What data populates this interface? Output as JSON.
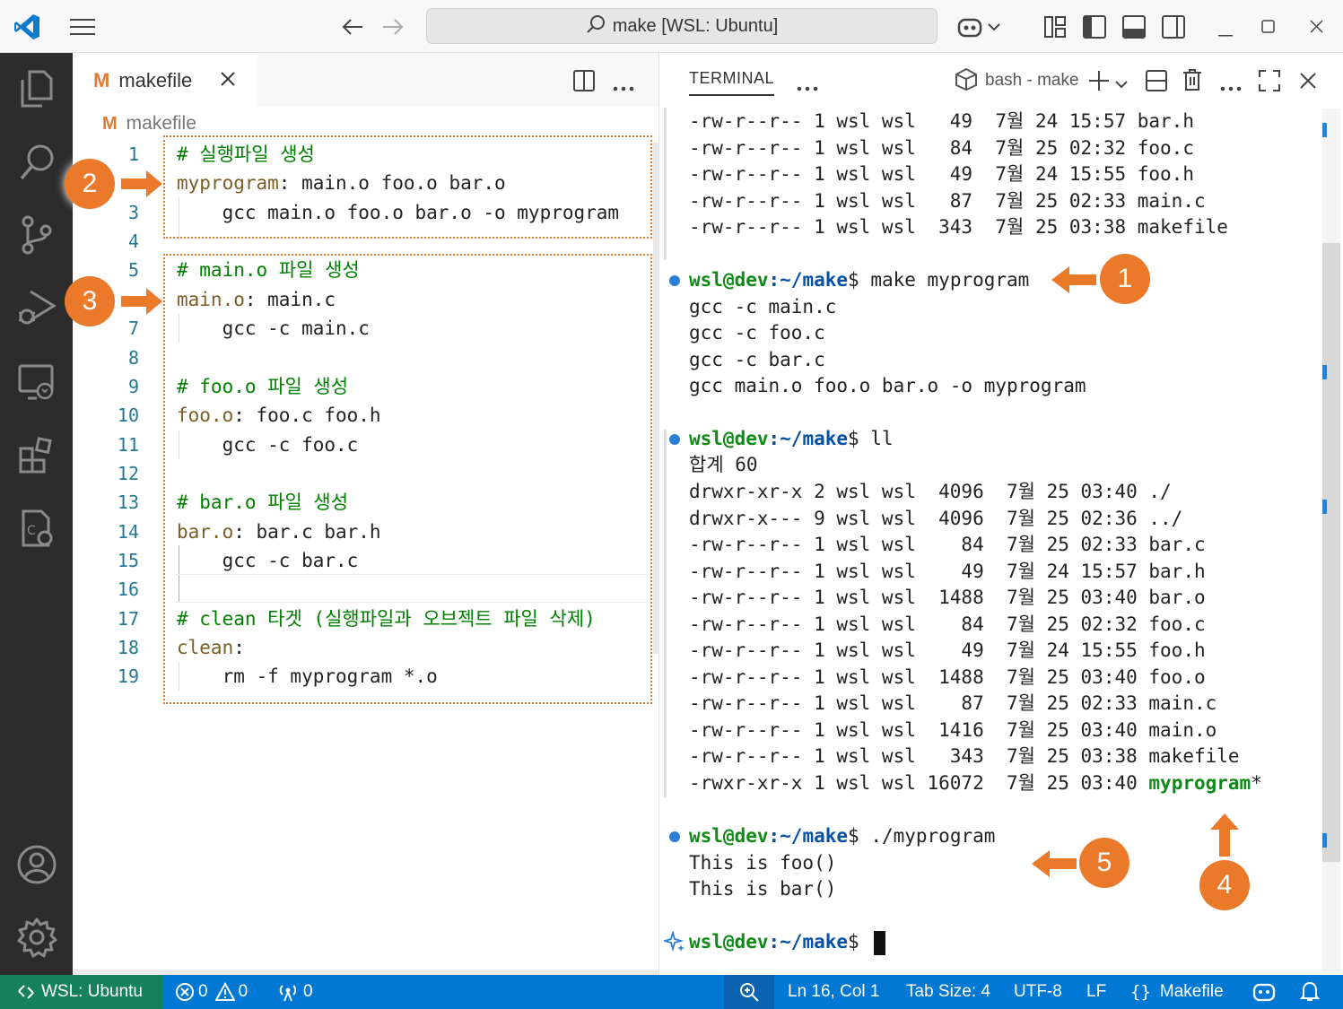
{
  "titlebar": {
    "search_text": "make [WSL: Ubuntu]"
  },
  "editor": {
    "tab_label": "makefile",
    "breadcrumb": "makefile",
    "lines": [
      {
        "n": "1",
        "parts": [
          [
            "cmt",
            "# 실행파일 생성"
          ]
        ]
      },
      {
        "n": "2",
        "parts": [
          [
            "tgt",
            "myprogram"
          ],
          [
            "",
            ": main.o foo.o bar.o"
          ]
        ]
      },
      {
        "n": "3",
        "parts": [
          [
            "",
            "    gcc main.o foo.o bar.o -o myprogram"
          ]
        ]
      },
      {
        "n": "4",
        "parts": [
          [
            "",
            ""
          ]
        ]
      },
      {
        "n": "5",
        "parts": [
          [
            "cmt",
            "# main.o 파일 생성"
          ]
        ]
      },
      {
        "n": "6",
        "parts": [
          [
            "tgt",
            "main.o"
          ],
          [
            "",
            ": main.c"
          ]
        ]
      },
      {
        "n": "7",
        "parts": [
          [
            "",
            "    gcc -c main.c"
          ]
        ]
      },
      {
        "n": "8",
        "parts": [
          [
            "",
            ""
          ]
        ]
      },
      {
        "n": "9",
        "parts": [
          [
            "cmt",
            "# foo.o 파일 생성"
          ]
        ]
      },
      {
        "n": "10",
        "parts": [
          [
            "tgt",
            "foo.o"
          ],
          [
            "",
            ": foo.c foo.h"
          ]
        ]
      },
      {
        "n": "11",
        "parts": [
          [
            "",
            "    gcc -c foo.c"
          ]
        ]
      },
      {
        "n": "12",
        "parts": [
          [
            "",
            ""
          ]
        ]
      },
      {
        "n": "13",
        "parts": [
          [
            "cmt",
            "# bar.o 파일 생성"
          ]
        ]
      },
      {
        "n": "14",
        "parts": [
          [
            "tgt",
            "bar.o"
          ],
          [
            "",
            ": bar.c bar.h"
          ]
        ]
      },
      {
        "n": "15",
        "parts": [
          [
            "",
            "    gcc -c bar.c"
          ]
        ]
      },
      {
        "n": "16",
        "parts": [
          [
            "",
            ""
          ]
        ]
      },
      {
        "n": "17",
        "parts": [
          [
            "cmt",
            "# clean 타겟 (실행파일과 오브젝트 파일 삭제)"
          ]
        ]
      },
      {
        "n": "18",
        "parts": [
          [
            "tgt",
            "clean"
          ],
          [
            "",
            ":"
          ]
        ]
      },
      {
        "n": "19",
        "parts": [
          [
            "",
            "    rm -f myprogram *.o"
          ]
        ]
      }
    ]
  },
  "terminal": {
    "tab_label": "TERMINAL",
    "shell_label": "bash - make",
    "lines": [
      {
        "t": "out",
        "text": "-rw-r--r-- 1 wsl wsl   49  7월 24 15:57 bar.h"
      },
      {
        "t": "out",
        "text": "-rw-r--r-- 1 wsl wsl   84  7월 25 02:32 foo.c"
      },
      {
        "t": "out",
        "text": "-rw-r--r-- 1 wsl wsl   49  7월 24 15:55 foo.h"
      },
      {
        "t": "out",
        "text": "-rw-r--r-- 1 wsl wsl   87  7월 25 02:33 main.c"
      },
      {
        "t": "out",
        "text": "-rw-r--r-- 1 wsl wsl  343  7월 25 03:38 makefile"
      },
      {
        "t": "blank",
        "text": ""
      },
      {
        "t": "prompt",
        "user": "wsl@dev",
        "path": ":~/make",
        "cmd": "$ make myprogram"
      },
      {
        "t": "out",
        "text": "gcc -c main.c"
      },
      {
        "t": "out",
        "text": "gcc -c foo.c"
      },
      {
        "t": "out",
        "text": "gcc -c bar.c"
      },
      {
        "t": "out",
        "text": "gcc main.o foo.o bar.o -o myprogram"
      },
      {
        "t": "blank",
        "text": ""
      },
      {
        "t": "prompt",
        "user": "wsl@dev",
        "path": ":~/make",
        "cmd": "$ ll"
      },
      {
        "t": "out",
        "text": "합계 60"
      },
      {
        "t": "out",
        "text": "drwxr-xr-x 2 wsl wsl  4096  7월 25 03:40 ./"
      },
      {
        "t": "out",
        "text": "drwxr-x--- 9 wsl wsl  4096  7월 25 02:36 ../"
      },
      {
        "t": "out",
        "text": "-rw-r--r-- 1 wsl wsl    84  7월 25 02:33 bar.c"
      },
      {
        "t": "out",
        "text": "-rw-r--r-- 1 wsl wsl    49  7월 24 15:57 bar.h"
      },
      {
        "t": "out",
        "text": "-rw-r--r-- 1 wsl wsl  1488  7월 25 03:40 bar.o"
      },
      {
        "t": "out",
        "text": "-rw-r--r-- 1 wsl wsl    84  7월 25 02:32 foo.c"
      },
      {
        "t": "out",
        "text": "-rw-r--r-- 1 wsl wsl    49  7월 24 15:55 foo.h"
      },
      {
        "t": "out",
        "text": "-rw-r--r-- 1 wsl wsl  1488  7월 25 03:40 foo.o"
      },
      {
        "t": "out",
        "text": "-rw-r--r-- 1 wsl wsl    87  7월 25 02:33 main.c"
      },
      {
        "t": "out",
        "text": "-rw-r--r-- 1 wsl wsl  1416  7월 25 03:40 main.o"
      },
      {
        "t": "out",
        "text": "-rw-r--r-- 1 wsl wsl   343  7월 25 03:38 makefile"
      },
      {
        "t": "exe",
        "text": "-rwxr-xr-x 1 wsl wsl 16072  7월 25 03:40 ",
        "name": "myprogram",
        "suffix": "*"
      },
      {
        "t": "blank",
        "text": ""
      },
      {
        "t": "prompt",
        "user": "wsl@dev",
        "path": ":~/make",
        "cmd": "$ ./myprogram"
      },
      {
        "t": "out",
        "text": "This is foo()"
      },
      {
        "t": "out",
        "text": "This is bar()"
      },
      {
        "t": "blank",
        "text": ""
      },
      {
        "t": "prompt-current",
        "user": "wsl@dev",
        "path": ":~/make",
        "cmd": "$ "
      }
    ]
  },
  "annotations": {
    "badge1": "1",
    "badge2": "2",
    "badge3": "3",
    "badge4": "4",
    "badge5": "5"
  },
  "statusbar": {
    "remote": "WSL: Ubuntu",
    "errors": "0",
    "warnings": "0",
    "ports": "0",
    "position": "Ln 16, Col 1",
    "tab_size": "Tab Size: 4",
    "encoding": "UTF-8",
    "eol": "LF",
    "language": "Makefile"
  },
  "colors": {
    "accent": "#0078d4",
    "annotation": "#ea7a2a",
    "activitybar": "#2c2c2c"
  }
}
